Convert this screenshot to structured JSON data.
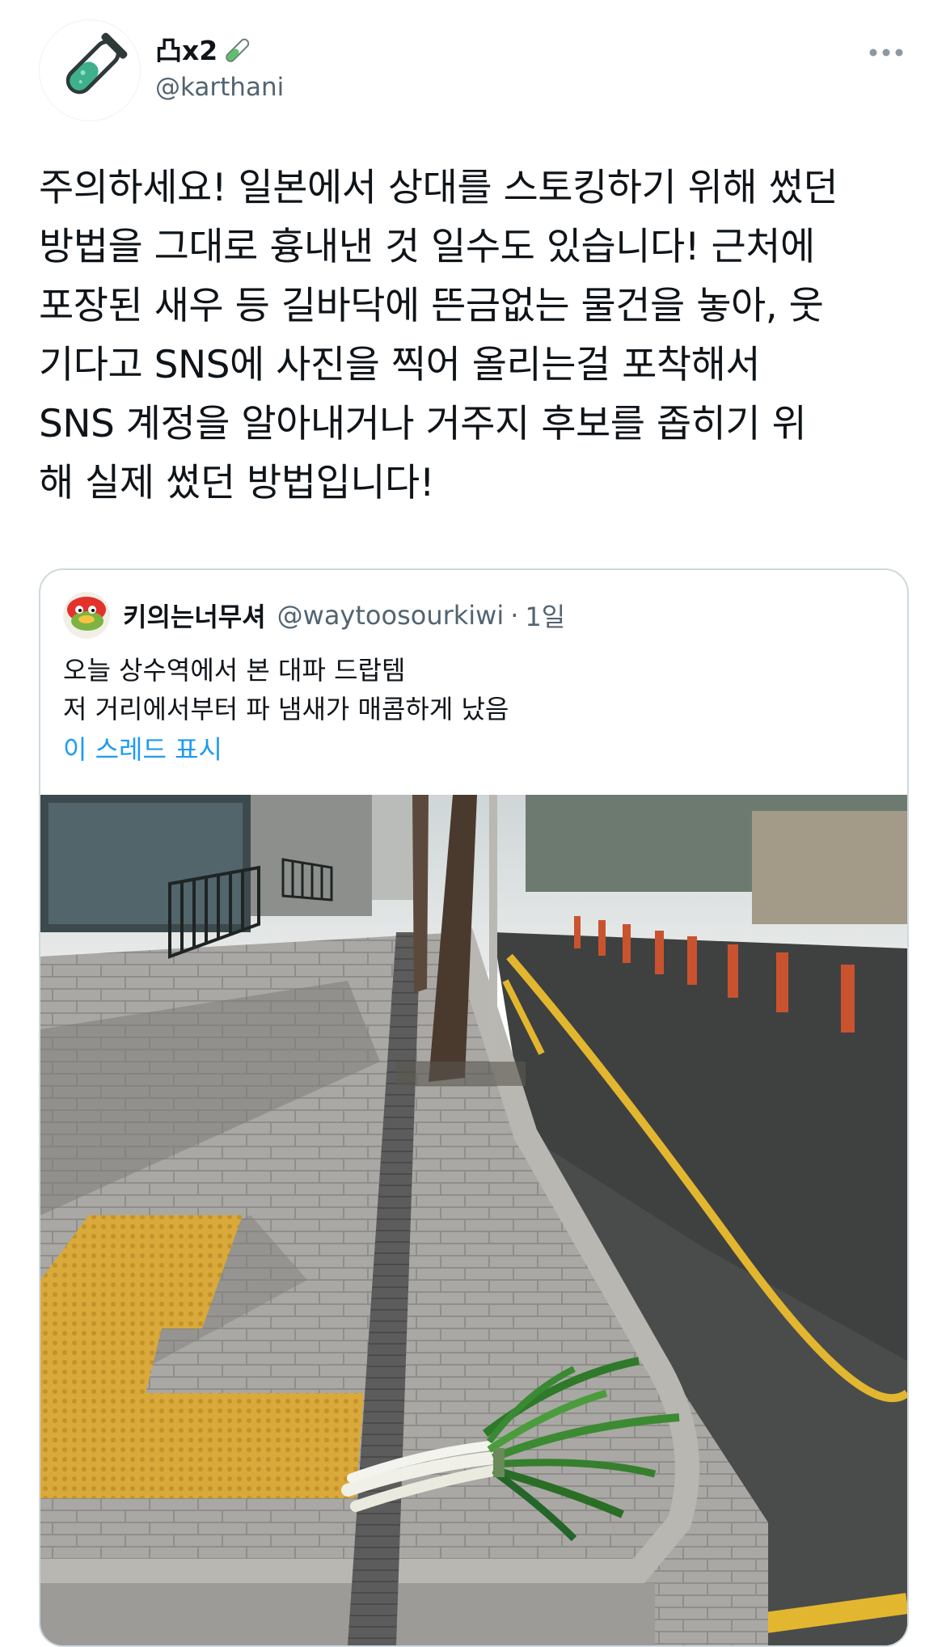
{
  "tweet": {
    "author": {
      "display_name": "凸x2",
      "name_emoji": "test-tube-emoji",
      "handle": "@karthani",
      "avatar_icon": "test-tube-icon"
    },
    "more_icon": "ellipsis-icon",
    "text": "주의하세요! 일본에서 상대를 스토킹하기 위해 썼던\n방법을 그대로 흉내낸 것 일수도 있습니다! 근처에\n포장된 새우 등 길바닥에 뜬금없는 물건을 놓아, 웃\n기다고 SNS에 사진을 찍어 올리는걸 포착해서\nSNS 계정을 알아내거나 거주지 후보를 좁히기 위\n해 실제 썼던 방법입니다!"
  },
  "quote": {
    "author": {
      "display_name": "키의는너무셔",
      "handle": "@waytoosourkiwi",
      "separator": "·",
      "time": "1일",
      "avatar_icon": "kiwi-character-icon"
    },
    "text": "오늘 상수역에서 본 대파 드랍템\n저 거리에서부터 파 냄새가 매콤하게 났음",
    "show_thread": "이 스레드 표시",
    "image": "photo-green-onions-on-sidewalk"
  },
  "colors": {
    "text_primary": "#0f1419",
    "text_secondary": "#536471",
    "link": "#1d9bf0",
    "border": "#cfd9de",
    "tactile_paving": "#d9a93a"
  }
}
